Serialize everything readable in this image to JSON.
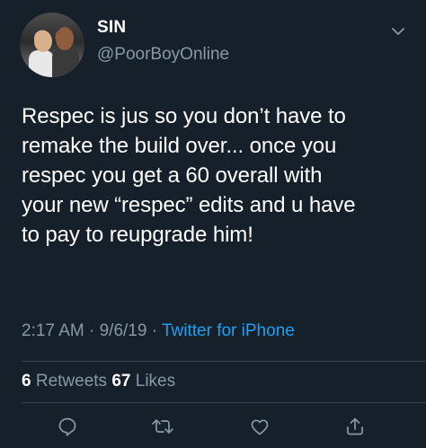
{
  "user": {
    "display_name": "SIN",
    "handle": "@PoorBoyOnline"
  },
  "tweet": {
    "text": "Respec is jus so you don’t have to\nremake the build over... once you\nrespec you get a 60 overall with\nyour new “respec” edits and u have\nto pay to reupgrade him!",
    "time": "2:17 AM",
    "separator": "·",
    "date": "9/6/19",
    "source": "Twitter for iPhone"
  },
  "stats": {
    "retweets_count": "6",
    "retweets_label": "Retweets",
    "likes_count": "67",
    "likes_label": "Likes"
  },
  "icons": {
    "more": "chevron-down-icon",
    "reply": "reply-icon",
    "retweet": "retweet-icon",
    "like": "heart-icon",
    "share": "share-icon"
  },
  "colors": {
    "background": "#15202b",
    "primary_text": "#ffffff",
    "secondary_text": "#8899a6",
    "accent": "#1da1f2",
    "divider": "#38444d"
  }
}
